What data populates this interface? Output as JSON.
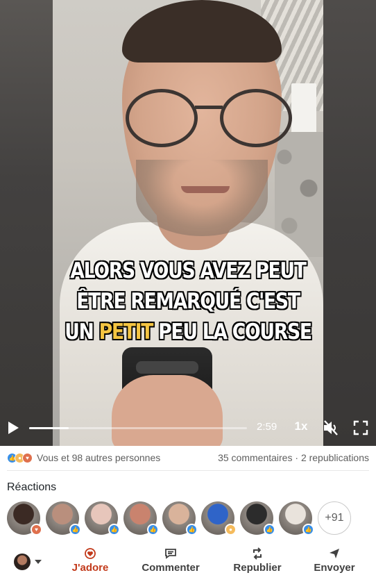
{
  "video": {
    "caption_lines": [
      {
        "before": "ALORS VOUS AVEZ PEUT",
        "highlight": "",
        "after": ""
      },
      {
        "before": "ÊTRE REMARQUÉ C'EST",
        "highlight": "",
        "after": ""
      },
      {
        "before": "UN ",
        "highlight": "PETIT",
        "after": " PEU LA COURSE"
      }
    ],
    "time": "2:59",
    "speed": "1x",
    "progress_fraction": 0.18,
    "muted": true,
    "colors": {
      "caption_highlight": "#f5c542"
    }
  },
  "social": {
    "reactions_text": "Vous et 98 autres personnes",
    "comments_text": "35 commentaires",
    "separator": " · ",
    "reposts_text": "2 republications"
  },
  "reactions": {
    "title": "Réactions",
    "people": [
      {
        "badge": "love",
        "face": "#3b2a24"
      },
      {
        "badge": "like",
        "face": "#b98f7d"
      },
      {
        "badge": "like",
        "face": "#e7c6bb"
      },
      {
        "badge": "like",
        "face": "#c9836e"
      },
      {
        "badge": "like",
        "face": "#d9b39b"
      },
      {
        "badge": "insight",
        "face": "#2f64c8"
      },
      {
        "badge": "like",
        "face": "#2c2c2c"
      },
      {
        "badge": "like",
        "face": "#e9e3dc"
      }
    ],
    "more": "+91"
  },
  "actions": {
    "adore": "J'adore",
    "comment": "Commenter",
    "repost": "Republier",
    "send": "Envoyer",
    "colors": {
      "active": "#c23a1b"
    }
  }
}
